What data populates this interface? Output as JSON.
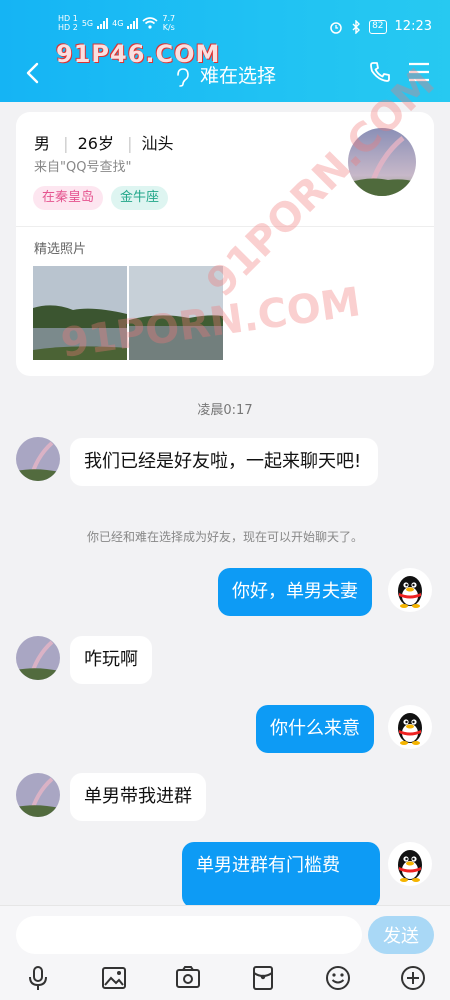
{
  "status_bar": {
    "sim1": "HD 1",
    "sim2": "HD 2",
    "net1": "5G",
    "net2": "4G",
    "speed": "7.7",
    "speed_unit": "K/s",
    "battery": "82",
    "time": "12:23"
  },
  "watermarks": [
    "91P46.COM",
    "91PORN.COM",
    "91PORN.COM"
  ],
  "header": {
    "title": "难在选择"
  },
  "profile": {
    "gender": "男",
    "age": "26岁",
    "city": "汕头",
    "source": "来自\"QQ号查找\"",
    "tags": [
      "在秦皇岛",
      "金牛座"
    ],
    "photos_label": "精选照片"
  },
  "chat": {
    "timestamp": "凌晨0:17",
    "system_message": "你已经和难在选择成为好友，现在可以开始聊天了。",
    "messages": [
      {
        "side": "in",
        "text": "我们已经是好友啦，一起来聊天吧!"
      },
      {
        "side": "out",
        "text": "你好，单男夫妻"
      },
      {
        "side": "in",
        "text": "咋玩啊"
      },
      {
        "side": "out",
        "text": "你什么来意"
      },
      {
        "side": "in",
        "text": "单男带我进群"
      },
      {
        "side": "out",
        "text": "单男进群有门槛费"
      }
    ]
  },
  "input": {
    "value": "",
    "send_label": "发送"
  },
  "toolbar": [
    "microphone-icon",
    "image-icon",
    "camera-icon",
    "red-packet-icon",
    "emoji-icon",
    "plus-icon"
  ]
}
